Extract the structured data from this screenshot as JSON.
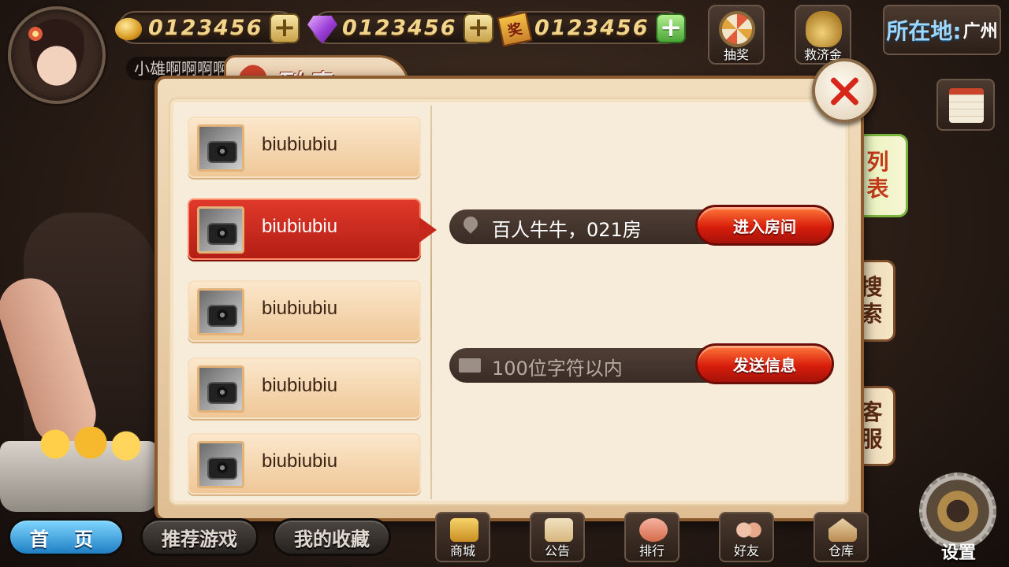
{
  "player": {
    "name": "小雄啊啊啊啊",
    "avatar_icon": "player-avatar-icon"
  },
  "currencies": [
    {
      "icon": "gold-coin-icon",
      "value": "0123456"
    },
    {
      "icon": "diamond-icon",
      "value": "0123456"
    },
    {
      "icon": "lottery-ticket-icon",
      "ticket_char": "奖",
      "value": "0123456"
    }
  ],
  "top_actions": {
    "lottery_label": "抽奖",
    "relief_fund_label": "救济金"
  },
  "location": {
    "label": "所在地:",
    "value": "广州"
  },
  "side_tabs": {
    "list": "列\n表",
    "search": "搜\n索",
    "service": "客\n服"
  },
  "modal": {
    "title": "列表",
    "friends": [
      {
        "name": "biubiubiu",
        "selected": false
      },
      {
        "name": "biubiubiu",
        "selected": true
      },
      {
        "name": "biubiubiu",
        "selected": false
      },
      {
        "name": "biubiubiu",
        "selected": false
      },
      {
        "name": "biubiubiu",
        "selected": false
      }
    ],
    "room": {
      "text": "百人牛牛，021房",
      "button": "进入房间"
    },
    "message": {
      "placeholder": "100位字符以内",
      "button": "发送信息"
    }
  },
  "bottom_nav": {
    "home": "首 页",
    "recommended": "推荐游戏",
    "favorites": "我的收藏",
    "shop": "商城",
    "notice": "公告",
    "ranking": "排行",
    "friends": "好友",
    "warehouse": "仓库",
    "settings": "设置"
  },
  "colors": {
    "accent_red": "#d81e0c",
    "panel_bg": "#f7ecd9",
    "active_tab_text": "#c23a1a",
    "home_pill": "#1f7fc4"
  }
}
